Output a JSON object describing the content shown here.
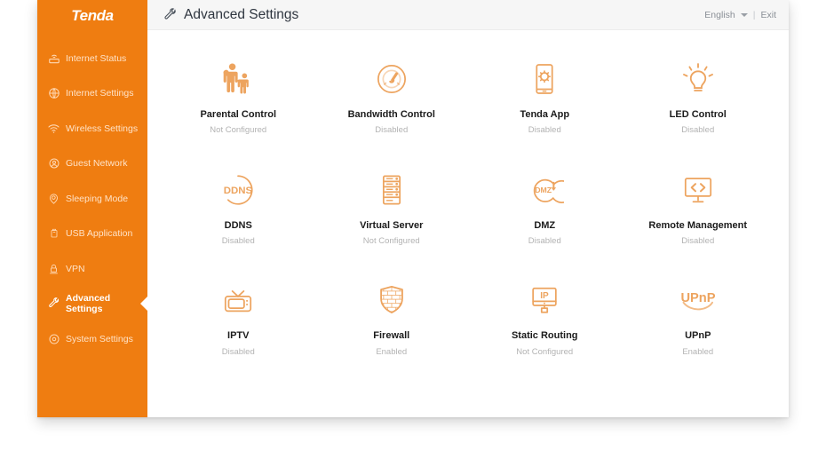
{
  "brand": {
    "logo_text": "Tenda"
  },
  "colors": {
    "sidebar_orange": "#ef7d11",
    "icon_orange": "#eda45f",
    "topbar_bg": "#f6f6f6",
    "label_dark": "#1b1b1b",
    "status_gray": "#b3b3b3"
  },
  "sidebar": {
    "items": [
      {
        "label": "Internet Status",
        "icon": "router-icon",
        "active": false
      },
      {
        "label": "Internet Settings",
        "icon": "globe-icon",
        "active": false
      },
      {
        "label": "Wireless Settings",
        "icon": "wifi-icon",
        "active": false
      },
      {
        "label": "Guest Network",
        "icon": "guest-network-icon",
        "active": false
      },
      {
        "label": "Sleeping Mode",
        "icon": "moon-pin-icon",
        "active": false
      },
      {
        "label": "USB Application",
        "icon": "usb-icon",
        "active": false
      },
      {
        "label": "VPN",
        "icon": "vpn-lock-icon",
        "active": false
      },
      {
        "label": "Advanced Settings",
        "icon": "wrench-icon",
        "active": true
      },
      {
        "label": "System Settings",
        "icon": "gear-circle-icon",
        "active": false
      }
    ]
  },
  "header": {
    "title": "Advanced Settings",
    "title_icon": "wrench-icon",
    "language": "English",
    "language_caret": "chevron-down-icon",
    "separator": "|",
    "exit": "Exit"
  },
  "main": {
    "tiles": [
      {
        "label": "Parental Control",
        "status": "Not Configured",
        "icon": "parent-child-icon"
      },
      {
        "label": "Bandwidth Control",
        "status": "Disabled",
        "icon": "speedometer-icon"
      },
      {
        "label": "Tenda App",
        "status": "Disabled",
        "icon": "phone-gear-icon"
      },
      {
        "label": "LED Control",
        "status": "Disabled",
        "icon": "lightbulb-icon"
      },
      {
        "label": "DDNS",
        "status": "Disabled",
        "icon": "ddns-circle-icon"
      },
      {
        "label": "Virtual Server",
        "status": "Not Configured",
        "icon": "server-rack-icon"
      },
      {
        "label": "DMZ",
        "status": "Disabled",
        "icon": "dmz-circle-icon"
      },
      {
        "label": "Remote Management",
        "status": "Disabled",
        "icon": "monitor-code-icon"
      },
      {
        "label": "IPTV",
        "status": "Disabled",
        "icon": "television-icon"
      },
      {
        "label": "Firewall",
        "status": "Enabled",
        "icon": "shield-icon"
      },
      {
        "label": "Static Routing",
        "status": "Not Configured",
        "icon": "monitor-ip-icon"
      },
      {
        "label": "UPnP",
        "status": "Enabled",
        "icon": "upnp-logo-icon"
      }
    ]
  }
}
